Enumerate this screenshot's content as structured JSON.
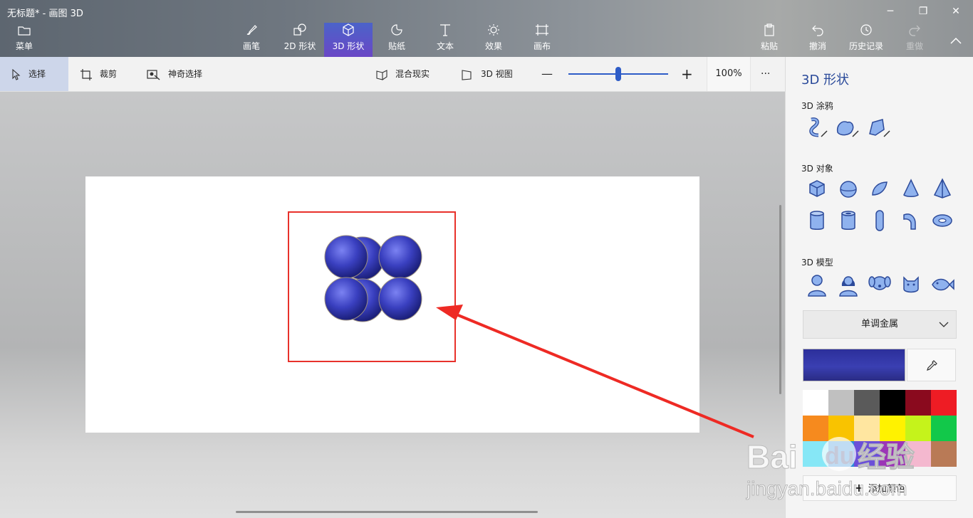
{
  "window": {
    "title": "无标题* - 画图 3D",
    "controls": [
      "─",
      "❐",
      "✕"
    ]
  },
  "toolbar": {
    "menu": {
      "label": "菜单",
      "icon": "folder-icon"
    },
    "tabs": [
      {
        "label": "画笔",
        "icon": "brush-icon"
      },
      {
        "label": "2D 形状",
        "icon": "2d-shapes-icon"
      },
      {
        "label": "3D 形状",
        "icon": "3d-cube-icon",
        "active": true
      },
      {
        "label": "贴纸",
        "icon": "sticker-icon"
      },
      {
        "label": "文本",
        "icon": "text-icon"
      },
      {
        "label": "效果",
        "icon": "sun-effects-icon"
      },
      {
        "label": "画布",
        "icon": "canvas-crop-icon"
      }
    ],
    "right": [
      {
        "label": "粘贴",
        "icon": "paste-icon"
      },
      {
        "label": "撤消",
        "icon": "undo-icon"
      },
      {
        "label": "历史记录",
        "icon": "history-icon"
      },
      {
        "label": "重做",
        "icon": "redo-icon",
        "disabled": true
      }
    ],
    "collapse_icon": "chevron-up-icon"
  },
  "subbar": {
    "select": "选择",
    "crop": "裁剪",
    "magic_select": "神奇选择",
    "mixed_reality": "混合现实",
    "view_3d": "3D 视图",
    "zoom_minus": "—",
    "zoom_plus": "+",
    "zoom_level": "100%",
    "zoom_value": 0.5,
    "more": "···"
  },
  "panel": {
    "title": "3D 形状",
    "doodle_heading": "3D 涂鸦",
    "doodles": [
      "sharp-edge-doodle-icon",
      "soft-edge-doodle-icon",
      "tube-doodle-icon"
    ],
    "objects_heading": "3D 对象",
    "objects": [
      "cube-icon",
      "sphere-icon",
      "hemisphere-icon",
      "cone-icon",
      "pyramid-icon",
      "cylinder-icon",
      "tube-icon",
      "capsule-icon",
      "curved-tube-icon",
      "donut-icon"
    ],
    "models_heading": "3D 模型",
    "models": [
      "man-icon",
      "woman-icon",
      "dog-icon",
      "cat-icon",
      "fish-icon"
    ],
    "material": "单调金属",
    "current_color": "#3034a4",
    "palette": [
      "#ffffff",
      "#c0c0c0",
      "#5a5a5a",
      "#000000",
      "#8a0a1e",
      "#ee1c24",
      "#f68a1e",
      "#f9c300",
      "#ffe6a0",
      "#fff200",
      "#c5f31b",
      "#12c84a",
      "#86e7f6",
      "#2d8bd8",
      "#6b4fd8",
      "#9b35b6",
      "#f4b8cf",
      "#b97a56"
    ],
    "add_color": "添加颜色"
  },
  "watermark": {
    "brand": "Bai",
    "suffix": "经验",
    "url": "jingyan.baidu.com"
  }
}
